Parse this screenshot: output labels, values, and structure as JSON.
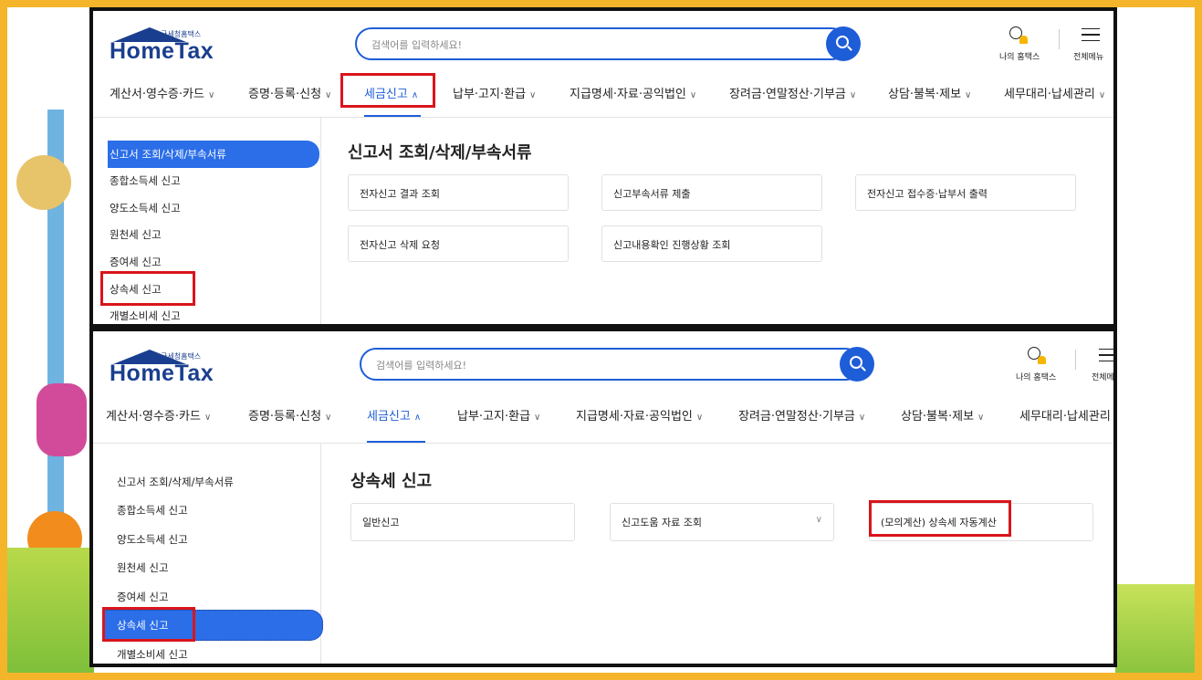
{
  "logo": {
    "sub": "국세청홈택스",
    "name": "HomeTax"
  },
  "search": {
    "placeholder": "검색어를 입력하세요!"
  },
  "util": {
    "my_hometax": "나의 홈택스",
    "full_menu": "전체메뉴",
    "full_menu_cut": "전체메"
  },
  "nav": {
    "items": [
      {
        "label": "계산서·영수증·카드"
      },
      {
        "label": "증명·등록·신청"
      },
      {
        "label": "세금신고"
      },
      {
        "label": "납부·고지·환급"
      },
      {
        "label": "지급명세·자료·공익법인"
      },
      {
        "label": "장려금·연말정산·기부금"
      },
      {
        "label": "상담·불복·제보"
      },
      {
        "label": "세무대리·납세관리"
      }
    ],
    "chevron_down": "∨",
    "chevron_up": "∧"
  },
  "sidebar": {
    "items": [
      {
        "label": "신고서 조회/삭제/부속서류"
      },
      {
        "label": "종합소득세 신고"
      },
      {
        "label": "양도소득세 신고"
      },
      {
        "label": "원천세 신고"
      },
      {
        "label": "증여세 신고"
      },
      {
        "label": "상속세 신고"
      },
      {
        "label": "개별소비세 신고"
      }
    ]
  },
  "panel1": {
    "title": "신고서 조회/삭제/부속서류",
    "cards": [
      {
        "label": "전자신고 결과 조회"
      },
      {
        "label": "신고부속서류 제출"
      },
      {
        "label": "전자신고 접수증·납부서 출력"
      },
      {
        "label": "전자신고 삭제 요청"
      },
      {
        "label": "신고내용확인 진행상황 조회"
      }
    ]
  },
  "panel2": {
    "title": "상속세 신고",
    "cards": [
      {
        "label": "일반신고"
      },
      {
        "label": "신고도움 자료 조회"
      },
      {
        "label": "(모의계산) 상속세 자동계산"
      }
    ]
  },
  "colors": {
    "brand": "#1a3e8f",
    "accent": "#1e5dd8",
    "highlight": "#d9151b",
    "active_bg": "#2b6ee8"
  },
  "icons": [
    "search-icon",
    "person-icon",
    "bell-icon",
    "menu-icon",
    "chevron-down-icon",
    "chevron-up-icon"
  ]
}
